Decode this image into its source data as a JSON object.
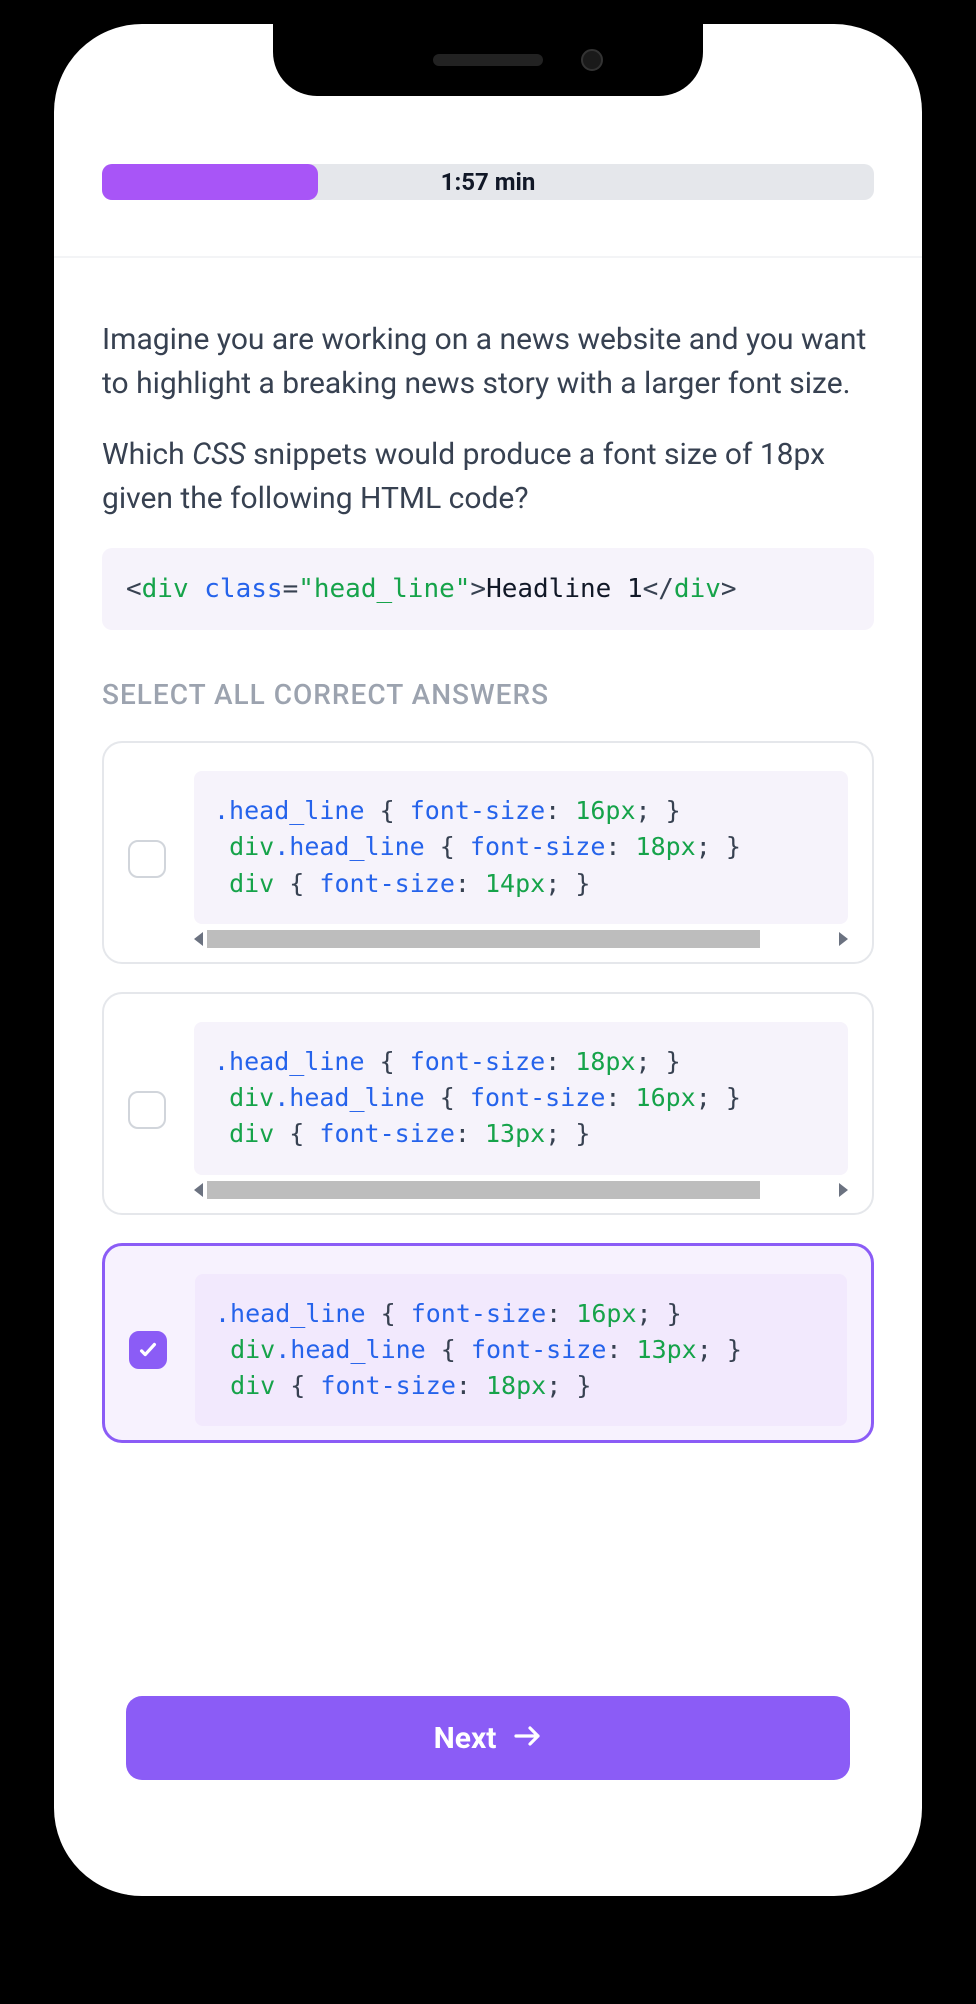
{
  "progress": {
    "percent": 28,
    "timer_label": "1:57 min"
  },
  "question": {
    "para1": "Imagine you are working on a news website and you want to highlight a breaking news story with a larger font size.",
    "para2_prefix": "Which ",
    "para2_em": "CSS",
    "para2_suffix": " snippets would produce a font size of 18px given the following HTML code?",
    "html_snippet": {
      "tag": "div",
      "attr_name": "class",
      "attr_value": "head_line",
      "text": "Headline 1"
    }
  },
  "instruction": "SELECT ALL CORRECT ANSWERS",
  "answers": [
    {
      "selected": false,
      "show_scrollbar": true,
      "lines": [
        {
          "indent": 0,
          "selector_parts": [
            {
              "t": "class",
              "v": ".head_line"
            }
          ],
          "prop": "font-size",
          "value": "16px"
        },
        {
          "indent": 1,
          "selector_parts": [
            {
              "t": "tag",
              "v": "div"
            },
            {
              "t": "class",
              "v": ".head_line"
            }
          ],
          "prop": "font-size",
          "value": "18px"
        },
        {
          "indent": 1,
          "selector_parts": [
            {
              "t": "tag",
              "v": "div"
            }
          ],
          "prop": "font-size",
          "value": "14px"
        }
      ]
    },
    {
      "selected": false,
      "show_scrollbar": true,
      "lines": [
        {
          "indent": 0,
          "selector_parts": [
            {
              "t": "class",
              "v": ".head_line"
            }
          ],
          "prop": "font-size",
          "value": "18px"
        },
        {
          "indent": 1,
          "selector_parts": [
            {
              "t": "tag",
              "v": "div"
            },
            {
              "t": "class",
              "v": ".head_line"
            }
          ],
          "prop": "font-size",
          "value": "16px"
        },
        {
          "indent": 1,
          "selector_parts": [
            {
              "t": "tag",
              "v": "div"
            }
          ],
          "prop": "font-size",
          "value": "13px"
        }
      ]
    },
    {
      "selected": true,
      "show_scrollbar": false,
      "lines": [
        {
          "indent": 0,
          "selector_parts": [
            {
              "t": "class",
              "v": ".head_line"
            }
          ],
          "prop": "font-size",
          "value": "16px"
        },
        {
          "indent": 1,
          "selector_parts": [
            {
              "t": "tag",
              "v": "div"
            },
            {
              "t": "class",
              "v": ".head_line"
            }
          ],
          "prop": "font-size",
          "value": "13px"
        },
        {
          "indent": 1,
          "selector_parts": [
            {
              "t": "tag",
              "v": "div"
            }
          ],
          "prop": "font-size",
          "value": "18px"
        }
      ]
    }
  ],
  "next_button_label": "Next"
}
